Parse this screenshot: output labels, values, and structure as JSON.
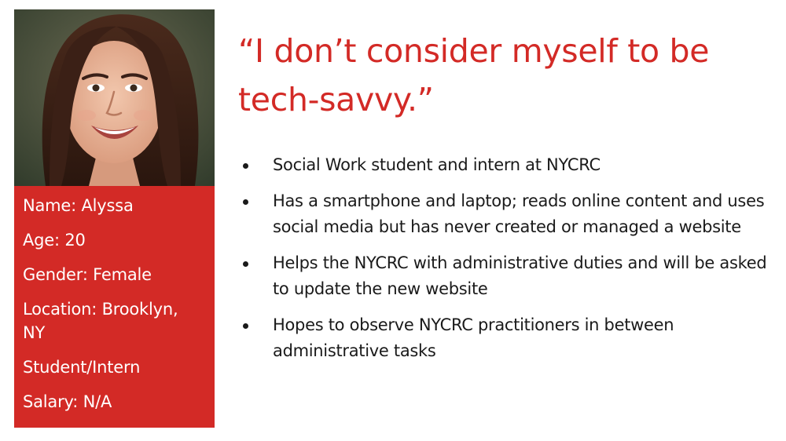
{
  "persona": {
    "name_line": "Name: Alyssa",
    "age_line": "Age: 20",
    "gender_line": "Gender: Female",
    "location_line": "Location: Brooklyn, NY",
    "role_line": "Student/Intern",
    "salary_line": "Salary: N/A"
  },
  "quote": "“I don’t consider myself to be tech-savvy.”",
  "bullets": [
    "Social Work student and intern at NYCRC",
    "Has a smartphone and laptop; reads online content and uses social media but has never created or managed a website",
    "Helps the NYCRC with administrative duties and will be asked to update the new website",
    "Hopes to observe NYCRC practitioners in between administrative tasks"
  ],
  "colors": {
    "accent": "#d32a26",
    "text": "#1a1a1a",
    "background": "#ffffff"
  }
}
